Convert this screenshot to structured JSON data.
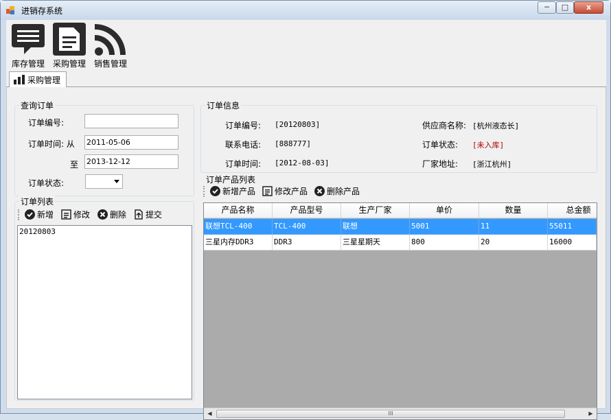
{
  "window": {
    "title": "进销存系统",
    "min": "─",
    "max": "□",
    "close": "x"
  },
  "toolbar": {
    "buttons": [
      {
        "label": "库存管理",
        "icon": "chat-bubble-icon"
      },
      {
        "label": "采购管理",
        "icon": "document-icon"
      },
      {
        "label": "销售管理",
        "icon": "rss-icon"
      }
    ]
  },
  "tab": {
    "label": "采购管理",
    "icon": "bar-chart-icon"
  },
  "query": {
    "title": "查询订单",
    "order_no_label": "订单编号:",
    "order_no_value": "",
    "time_label": "订单时间: 从",
    "time_from": "2011-05-06",
    "to_label": "至",
    "time_to": "2013-12-12",
    "status_label": "订单状态:",
    "status_value": ""
  },
  "order_list": {
    "title": "订单列表",
    "toolbar": [
      "新增",
      "修改",
      "删除",
      "提交"
    ],
    "items": [
      "20120803"
    ]
  },
  "order_info": {
    "title": "订单信息",
    "fields": {
      "order_no_label": "订单编号:",
      "order_no": "[20120803]",
      "phone_label": "联系电话:",
      "phone": "[888777]",
      "time_label": "订单时间:",
      "time": "[2012-08-03]",
      "supplier_label": "供应商名称:",
      "supplier": "[杭州液态长]",
      "status_label": "订单状态:",
      "status": "[未入库]",
      "address_label": "厂家地址:",
      "address": "[浙江杭州]"
    },
    "status_color": "#b00000"
  },
  "product_list": {
    "title": "订单产品列表",
    "toolbar": [
      "新增产品",
      "修改产品",
      "删除产品"
    ],
    "columns": [
      "产品名称",
      "产品型号",
      "生产厂家",
      "单价",
      "数量",
      "总金额"
    ],
    "rows": [
      [
        "联想TCL-400",
        "TCL-400",
        "联想",
        "5001",
        "11",
        "55011"
      ],
      [
        "三星内存DDR3",
        "DDR3",
        "三星星期天",
        "800",
        "20",
        "16000"
      ]
    ],
    "scroll_left": "◀",
    "scroll_right": "▶",
    "scroll_thumb": "III"
  },
  "colors": {
    "selection": "#3399ff",
    "grid_bg": "#ababab"
  }
}
